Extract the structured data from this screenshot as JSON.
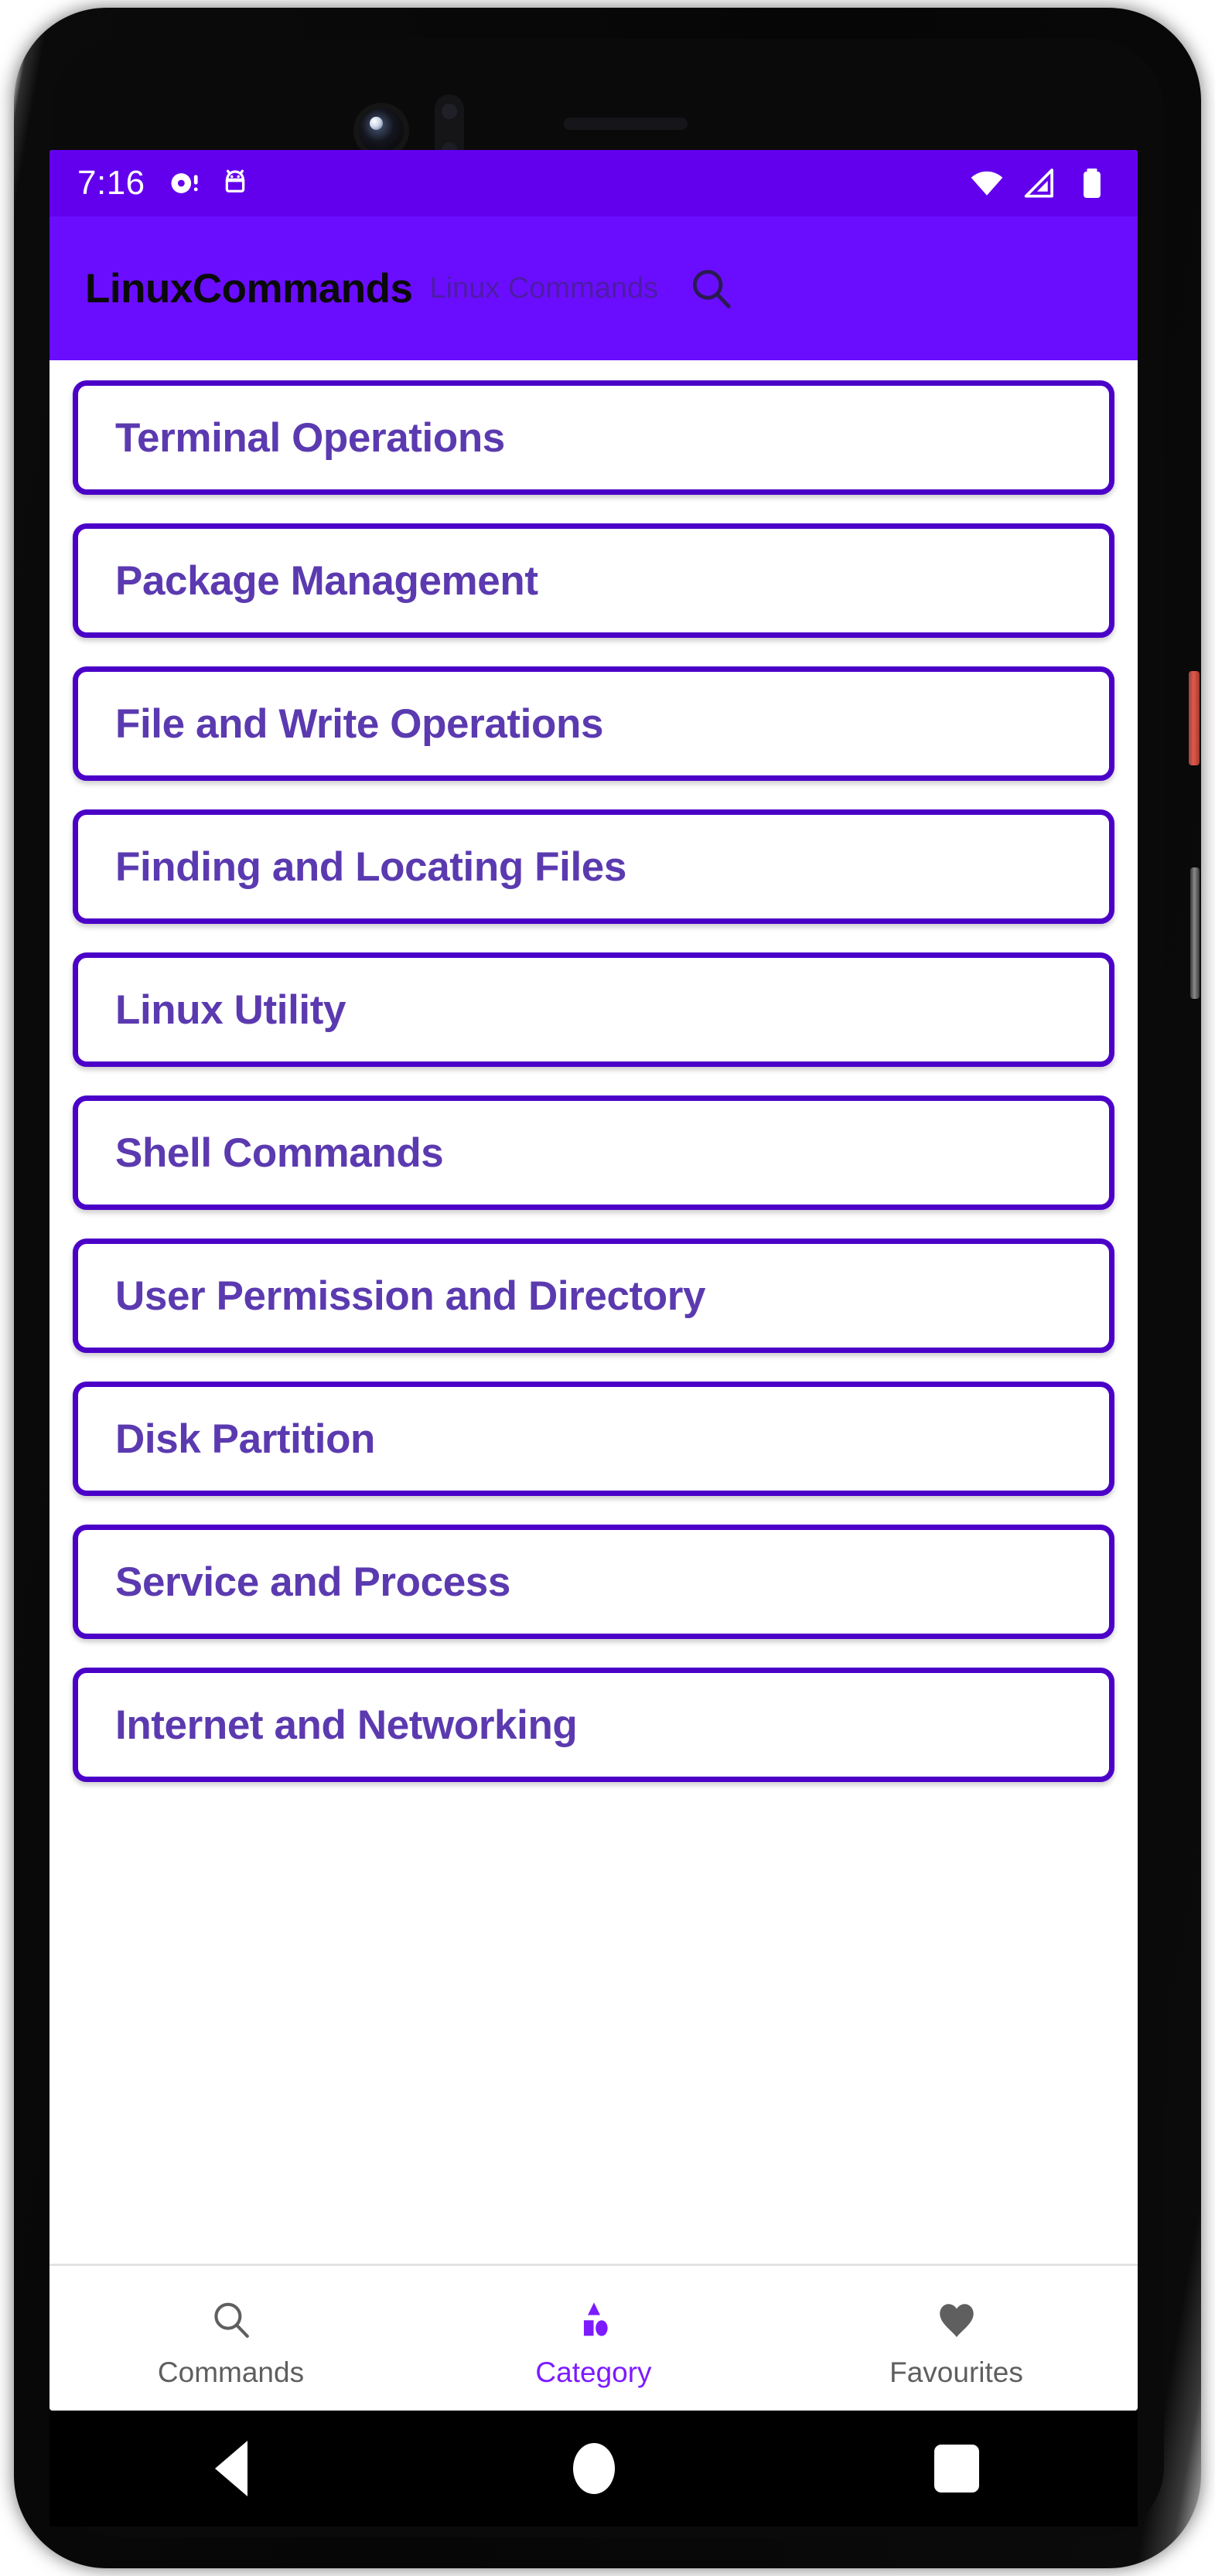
{
  "status_bar": {
    "time": "7:16",
    "left_icons": [
      "record-dot-icon",
      "android-debug-icon"
    ],
    "right_icons": [
      "wifi-icon",
      "cell-signal-icon",
      "battery-icon"
    ],
    "background_color": "#6200ee"
  },
  "app_bar": {
    "title": "LinuxCommands",
    "subtitle": "Linux Commands",
    "search_icon": "search-icon",
    "background_color": "#6a0dff",
    "title_color": "#0a0a0a",
    "subtitle_color": "#3d2470"
  },
  "categories": {
    "border_color": "#4b00c8",
    "label_color": "#5b3ab0",
    "items": [
      {
        "label": "Terminal Operations"
      },
      {
        "label": "Package Management"
      },
      {
        "label": "File and Write Operations"
      },
      {
        "label": "Finding and Locating Files"
      },
      {
        "label": "Linux Utility"
      },
      {
        "label": "Shell Commands"
      },
      {
        "label": "User Permission and Directory"
      },
      {
        "label": "Disk Partition"
      },
      {
        "label": "Service and Process"
      },
      {
        "label": "Internet and Networking"
      }
    ]
  },
  "bottom_nav": {
    "active_color": "#7c1bff",
    "inactive_color": "#5f5f5f",
    "items": [
      {
        "label": "Commands",
        "icon": "search-icon",
        "active": false
      },
      {
        "label": "Category",
        "icon": "shapes-icon",
        "active": true
      },
      {
        "label": "Favourites",
        "icon": "heart-icon",
        "active": false
      }
    ]
  },
  "android_nav_bar": {
    "back_label": "Back",
    "home_label": "Home",
    "recents_label": "Recents"
  }
}
